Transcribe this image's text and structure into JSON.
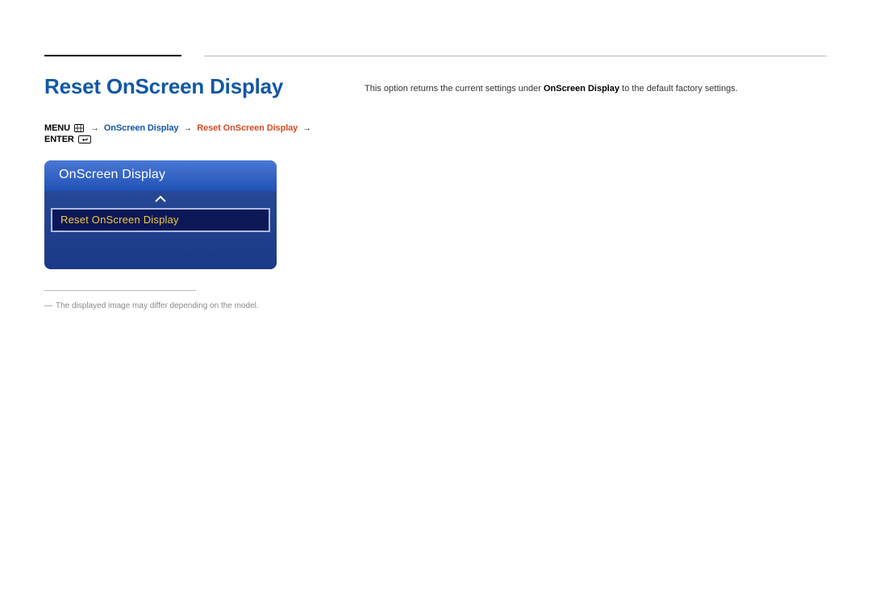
{
  "header": {
    "title": "Reset OnScreen Display"
  },
  "breadcrumb": {
    "menu_label": "MENU",
    "level1": "OnScreen Display",
    "level2": "Reset OnScreen Display",
    "enter_label": "ENTER",
    "arrow": "→"
  },
  "osd_panel": {
    "title": "OnScreen Display",
    "selected_item": "Reset OnScreen Display"
  },
  "footnote": {
    "prefix": "―",
    "text": "The displayed image may differ depending on the model."
  },
  "description": {
    "pre": "This option returns the current settings under ",
    "bold": "OnScreen Display",
    "post": " to the default factory settings."
  },
  "icons": {
    "menu": "menu-grid-icon",
    "enter": "enter-return-icon",
    "up": "chevron-up-icon"
  }
}
